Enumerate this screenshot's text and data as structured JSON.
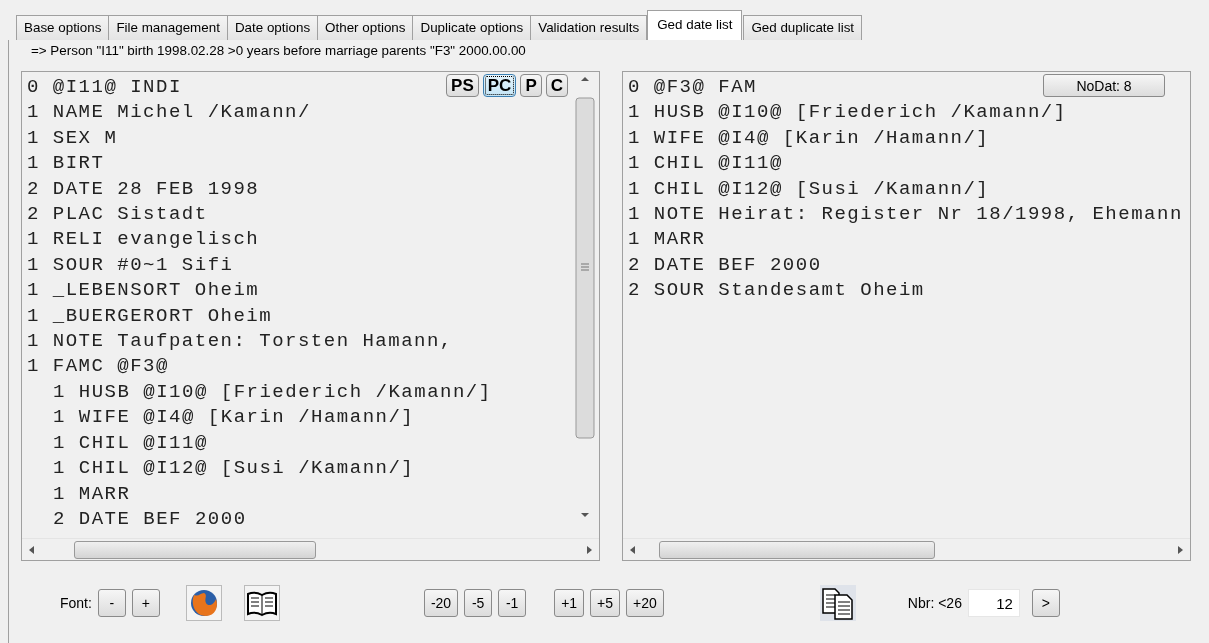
{
  "tabs": [
    {
      "label": "Base options",
      "selected": false
    },
    {
      "label": "File management",
      "selected": false
    },
    {
      "label": "Date options",
      "selected": false
    },
    {
      "label": "Other options",
      "selected": false
    },
    {
      "label": "Duplicate options",
      "selected": false
    },
    {
      "label": "Validation results",
      "selected": false
    },
    {
      "label": "Ged date list",
      "selected": true
    },
    {
      "label": "Ged duplicate list",
      "selected": false
    }
  ],
  "message": "=> Person \"I11\" birth 1998.02.28 >0 years before marriage parents \"F3\" 2000.00.00",
  "left_pane": {
    "buttons": [
      {
        "label": "PS",
        "focused": false
      },
      {
        "label": "PC",
        "focused": true
      },
      {
        "label": "P",
        "focused": false
      },
      {
        "label": "C",
        "focused": false
      }
    ],
    "lines": [
      {
        "text": "0 @I11@ INDI"
      },
      {
        "text": "1 NAME Michel /Kamann/"
      },
      {
        "text": "1 SEX M"
      },
      {
        "text": "1 BIRT"
      },
      {
        "text": "2 DATE 28 FEB 1998"
      },
      {
        "text": "2 PLAC Sistadt"
      },
      {
        "text": "1 RELI evangelisch"
      },
      {
        "text": "1 SOUR #0~1 Sifi"
      },
      {
        "text": "1 _LEBENSORT Oheim"
      },
      {
        "text": "1 _BUERGERORT Oheim"
      },
      {
        "text": "1 NOTE Taufpaten: Torsten Hamann,"
      },
      {
        "text": "1 FAMC @F3@",
        "children": [
          {
            "text": "1 HUSB @I10@ [Friederich /Kamann/]"
          },
          {
            "text": "1 WIFE @I4@ [Karin /Hamann/]"
          },
          {
            "text": "1 CHIL @I11@"
          },
          {
            "text": "1 CHIL @I12@ [Susi /Kamann/]"
          },
          {
            "text": "1 MARR"
          },
          {
            "text": "2 DATE BEF 2000"
          }
        ]
      }
    ]
  },
  "right_pane": {
    "buttons": [
      {
        "label": "NoDat: 8",
        "focused": false
      }
    ],
    "lines": [
      {
        "text": "0 @F3@ FAM"
      },
      {
        "text": "1 HUSB @I10@ [Friederich /Kamann/]"
      },
      {
        "text": "1 WIFE @I4@ [Karin /Hamann/]"
      },
      {
        "text": "1 CHIL @I11@"
      },
      {
        "text": "1 CHIL @I12@ [Susi /Kamann/]"
      },
      {
        "text": "1 NOTE Heirat: Register Nr 18/1998, Ehemann"
      },
      {
        "text": "1 MARR"
      },
      {
        "text": "2 DATE BEF 2000"
      },
      {
        "text": "2 SOUR Standesamt Oheim"
      }
    ]
  },
  "bottom_bar": {
    "font_label": "Font:",
    "font_buttons": [
      "-",
      "+"
    ],
    "step_buttons": [
      "-20",
      "-5",
      "-1",
      "+1",
      "+5",
      "+20"
    ],
    "nbr_label": "Nbr: <26",
    "nbr_value": "12",
    "next_button": ">"
  }
}
